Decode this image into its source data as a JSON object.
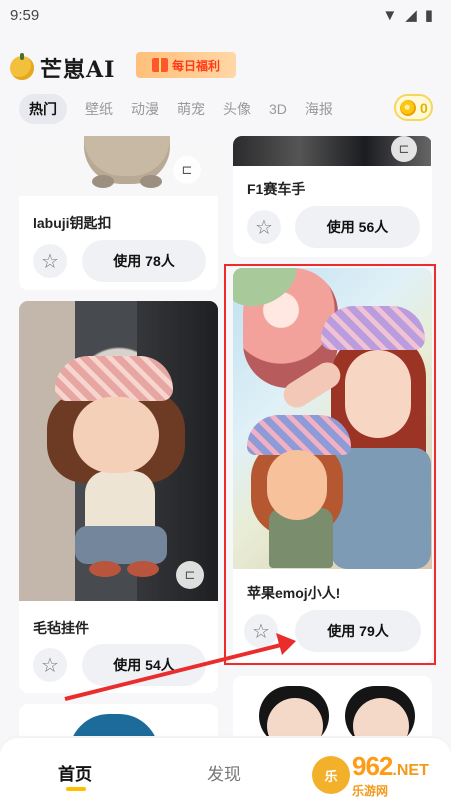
{
  "status_bar": {
    "time": "9:59"
  },
  "app": {
    "brand": "芒崽AI",
    "daily_welfare": "每日福利",
    "coin_count": "0"
  },
  "tabs": [
    {
      "label": "热门"
    },
    {
      "label": "壁纸"
    },
    {
      "label": "动漫"
    },
    {
      "label": "萌宠"
    },
    {
      "label": "头像"
    },
    {
      "label": "3D"
    },
    {
      "label": "海报"
    }
  ],
  "cards": [
    {
      "title": "labuji钥匙扣",
      "use_label": "使用 78人"
    },
    {
      "title": "毛毡挂件",
      "use_label": "使用 54人"
    },
    {
      "title": "F1赛车手",
      "use_label": "使用 56人"
    },
    {
      "title": "苹果emoj小人!",
      "use_label": "使用 79人"
    }
  ],
  "bottom_nav": [
    {
      "label": "首页"
    },
    {
      "label": "发现"
    }
  ],
  "watermark": {
    "number": "962",
    "net": ".NET",
    "text": "乐游网"
  },
  "icons": {
    "star": "star-icon",
    "compare": "compare-icon"
  }
}
